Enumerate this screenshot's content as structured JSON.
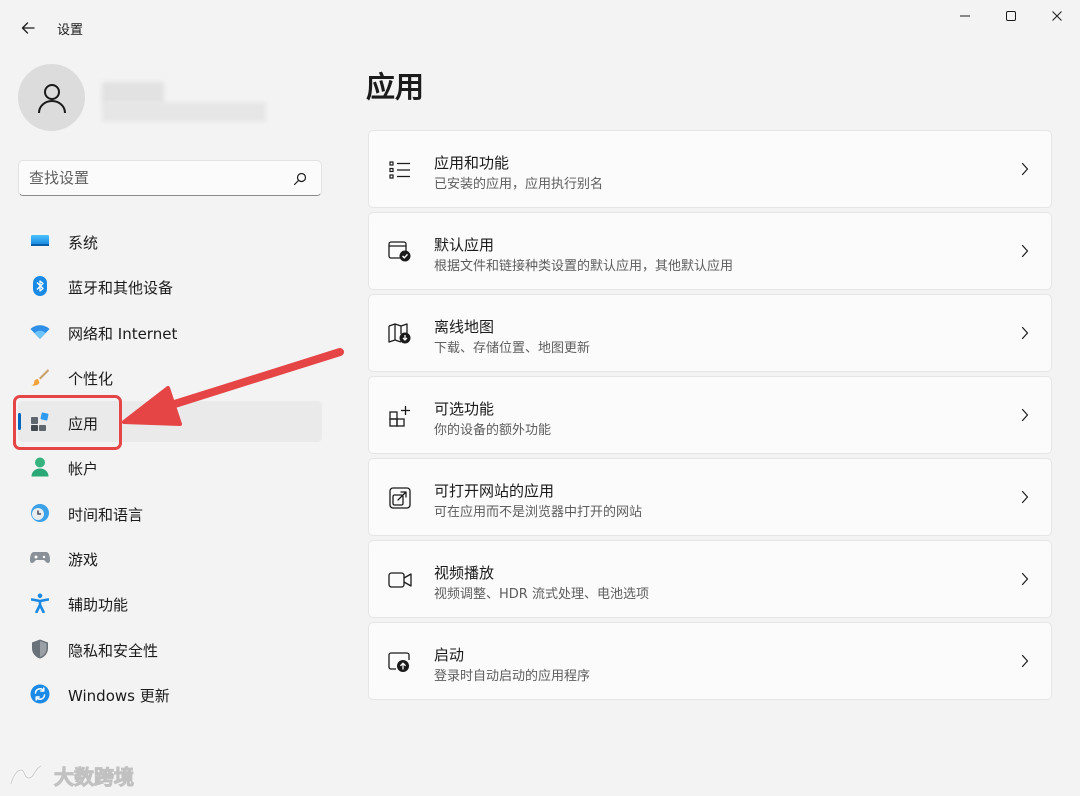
{
  "window": {
    "title": "设置"
  },
  "search": {
    "placeholder": "查找设置"
  },
  "sidebar": {
    "items": [
      {
        "label": "系统",
        "icon": "monitor-icon"
      },
      {
        "label": "蓝牙和其他设备",
        "icon": "bluetooth-icon"
      },
      {
        "label": "网络和 Internet",
        "icon": "wifi-icon"
      },
      {
        "label": "个性化",
        "icon": "brush-icon"
      },
      {
        "label": "应用",
        "icon": "apps-icon",
        "active": true
      },
      {
        "label": "帐户",
        "icon": "person-icon"
      },
      {
        "label": "时间和语言",
        "icon": "globe-clock-icon"
      },
      {
        "label": "游戏",
        "icon": "gamepad-icon"
      },
      {
        "label": "辅助功能",
        "icon": "accessibility-icon"
      },
      {
        "label": "隐私和安全性",
        "icon": "shield-icon"
      },
      {
        "label": "Windows 更新",
        "icon": "update-icon"
      }
    ]
  },
  "main": {
    "title": "应用",
    "cards": [
      {
        "title": "应用和功能",
        "subtitle": "已安装的应用，应用执行别名",
        "icon": "list-icon"
      },
      {
        "title": "默认应用",
        "subtitle": "根据文件和链接种类设置的默认应用，其他默认应用",
        "icon": "default-app-icon"
      },
      {
        "title": "离线地图",
        "subtitle": "下载、存储位置、地图更新",
        "icon": "map-download-icon"
      },
      {
        "title": "可选功能",
        "subtitle": "你的设备的额外功能",
        "icon": "add-feature-icon"
      },
      {
        "title": "可打开网站的应用",
        "subtitle": "可在应用而不是浏览器中打开的网站",
        "icon": "open-link-icon"
      },
      {
        "title": "视频播放",
        "subtitle": "视频调整、HDR 流式处理、电池选项",
        "icon": "video-icon"
      },
      {
        "title": "启动",
        "subtitle": "登录时自动启动的应用程序",
        "icon": "startup-icon"
      }
    ]
  },
  "watermark": {
    "text": "大数跨境"
  },
  "colors": {
    "accent": "#0067c0",
    "highlight": "#e64545",
    "background": "#f3f3f3",
    "card": "#fbfbfb"
  }
}
